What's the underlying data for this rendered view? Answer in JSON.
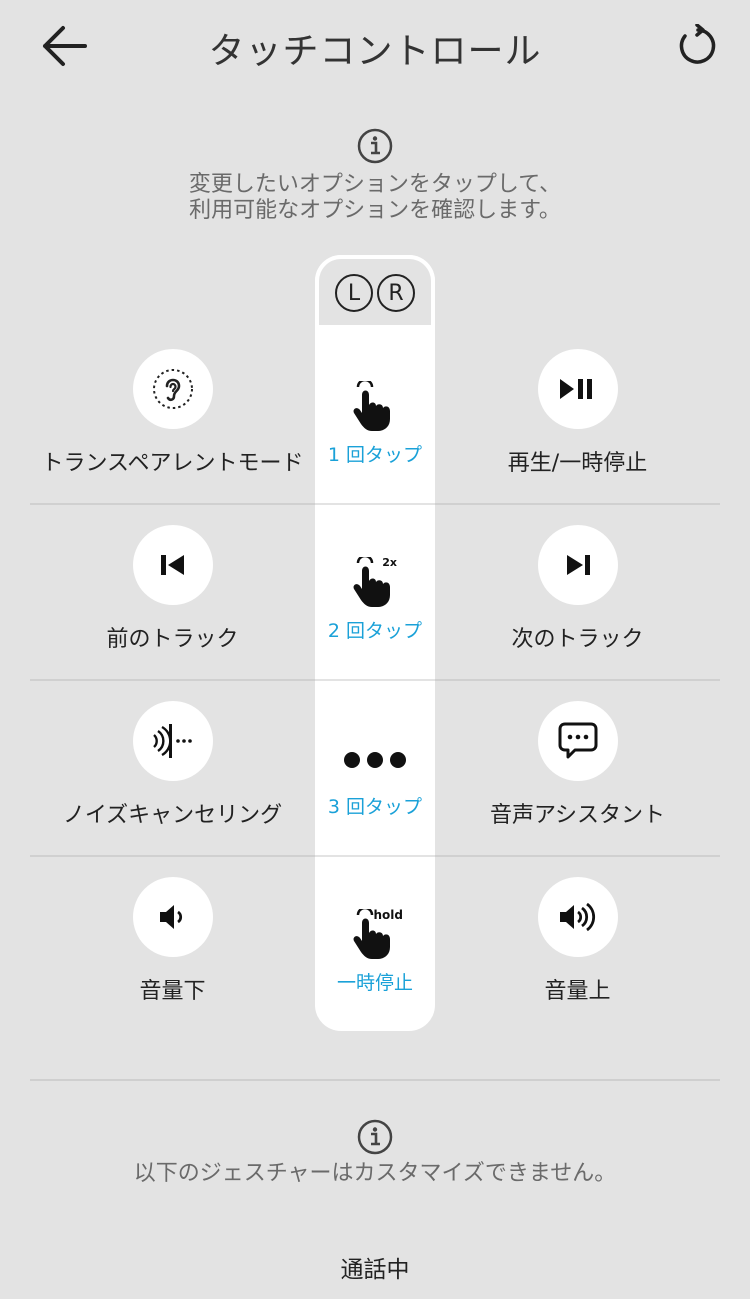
{
  "header": {
    "title": "タッチコントロール",
    "back_icon": "arrow-left-icon",
    "reset_icon": "refresh-icon"
  },
  "top_info": {
    "icon": "info-icon",
    "line1": "変更したいオプションをタップして、",
    "line2": "利用可能なオプションを確認します。"
  },
  "lr_header": {
    "left": "L",
    "right": "R"
  },
  "rows": [
    {
      "gesture_label": "1 回タップ",
      "gesture_icon": "single-tap-hand-icon",
      "left": {
        "label": "トランスペアレントモード",
        "icon": "ear-icon"
      },
      "right": {
        "label": "再生/一時停止",
        "icon": "play-pause-icon"
      }
    },
    {
      "gesture_label": "2 回タップ",
      "gesture_icon": "double-tap-hand-icon",
      "gesture_badge": "2x",
      "left": {
        "label": "前のトラック",
        "icon": "previous-track-icon"
      },
      "right": {
        "label": "次のトラック",
        "icon": "next-track-icon"
      }
    },
    {
      "gesture_label": "3 回タップ",
      "gesture_icon": "triple-dots-icon",
      "left": {
        "label": "ノイズキャンセリング",
        "icon": "noise-cancel-icon"
      },
      "right": {
        "label": "音声アシスタント",
        "icon": "chat-bubble-icon"
      }
    },
    {
      "gesture_label": "一時停止",
      "gesture_icon": "hold-hand-icon",
      "gesture_badge": "hold",
      "left": {
        "label": "音量下",
        "icon": "volume-down-icon"
      },
      "right": {
        "label": "音量上",
        "icon": "volume-up-icon"
      }
    }
  ],
  "bottom_info": {
    "icon": "info-icon",
    "text": "以下のジェスチャーはカスタマイズできません。"
  },
  "footer": {
    "label": "通話中"
  },
  "colors": {
    "background": "#e3e3e3",
    "accent": "#1aa1d8",
    "card": "#ffffff"
  }
}
